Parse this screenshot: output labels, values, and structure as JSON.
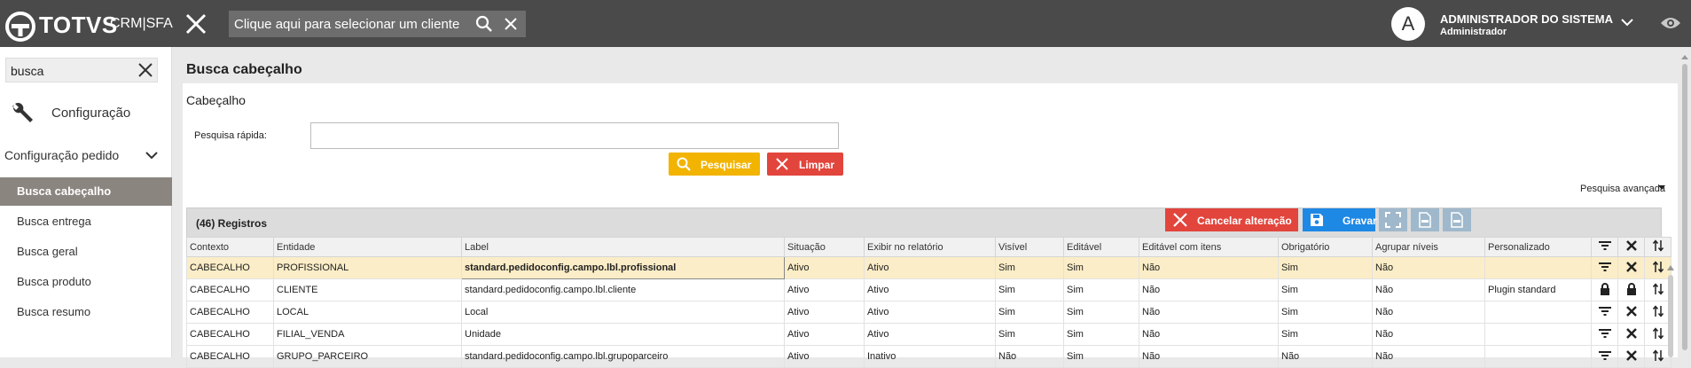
{
  "header": {
    "brand": "TOTVS",
    "brand_sub": "CRM|SFA",
    "client_placeholder": "Clique aqui para selecionar um cliente",
    "avatar_letter": "A",
    "user_name": "ADMINISTRADOR DO SISTEMA",
    "user_role": "Administrador"
  },
  "sidebar": {
    "search_value": "busca",
    "config_label": "Configuração",
    "group_label": "Configuração pedido",
    "items": [
      {
        "label": "Busca cabeçalho",
        "active": true
      },
      {
        "label": "Busca entrega"
      },
      {
        "label": "Busca geral"
      },
      {
        "label": "Busca produto"
      },
      {
        "label": "Busca resumo"
      }
    ]
  },
  "main": {
    "title": "Busca cabeçalho",
    "section_title": "Cabeçalho",
    "quick_search_label": "Pesquisa rápida:",
    "search_button": "Pesquisar",
    "clear_button": "Limpar",
    "advanced_search": "Pesquisa avançada",
    "records": "(46) Registros",
    "cancel_button": "Cancelar alteração",
    "save_button": "Gravar"
  },
  "table": {
    "columns": [
      "Contexto",
      "Entidade",
      "Label",
      "Situação",
      "Exibir no relatório",
      "Visível",
      "Editável",
      "Editável com itens",
      "Obrigatório",
      "Agrupar níveis",
      "Personalizado"
    ],
    "rows": [
      [
        "CABECALHO",
        "PROFISSIONAL",
        "standard.pedidoconfig.campo.lbl.profissional",
        "Ativo",
        "Ativo",
        "Sim",
        "Sim",
        "Não",
        "Sim",
        "Não",
        ""
      ],
      [
        "CABECALHO",
        "CLIENTE",
        "standard.pedidoconfig.campo.lbl.cliente",
        "Ativo",
        "Ativo",
        "Sim",
        "Sim",
        "Não",
        "Sim",
        "Não",
        "Plugin standard"
      ],
      [
        "CABECALHO",
        "LOCAL",
        "Local",
        "Ativo",
        "Ativo",
        "Sim",
        "Sim",
        "Não",
        "Sim",
        "Não",
        ""
      ],
      [
        "CABECALHO",
        "FILIAL_VENDA",
        "Unidade",
        "Ativo",
        "Ativo",
        "Sim",
        "Sim",
        "Não",
        "Sim",
        "Não",
        ""
      ],
      [
        "CABECALHO",
        "GRUPO_PARCEIRO",
        "standard.pedidoconfig.campo.lbl.grupoparceiro",
        "Ativo",
        "Inativo",
        "Não",
        "Sim",
        "Não",
        "Não",
        "Não",
        ""
      ]
    ]
  },
  "colors": {
    "topbar": "#4a4a4a",
    "active_item": "#8b8580",
    "search_button": "#f2b400",
    "danger": "#e2453c",
    "save": "#1e88e5",
    "selected_row": "#fbedc7"
  }
}
